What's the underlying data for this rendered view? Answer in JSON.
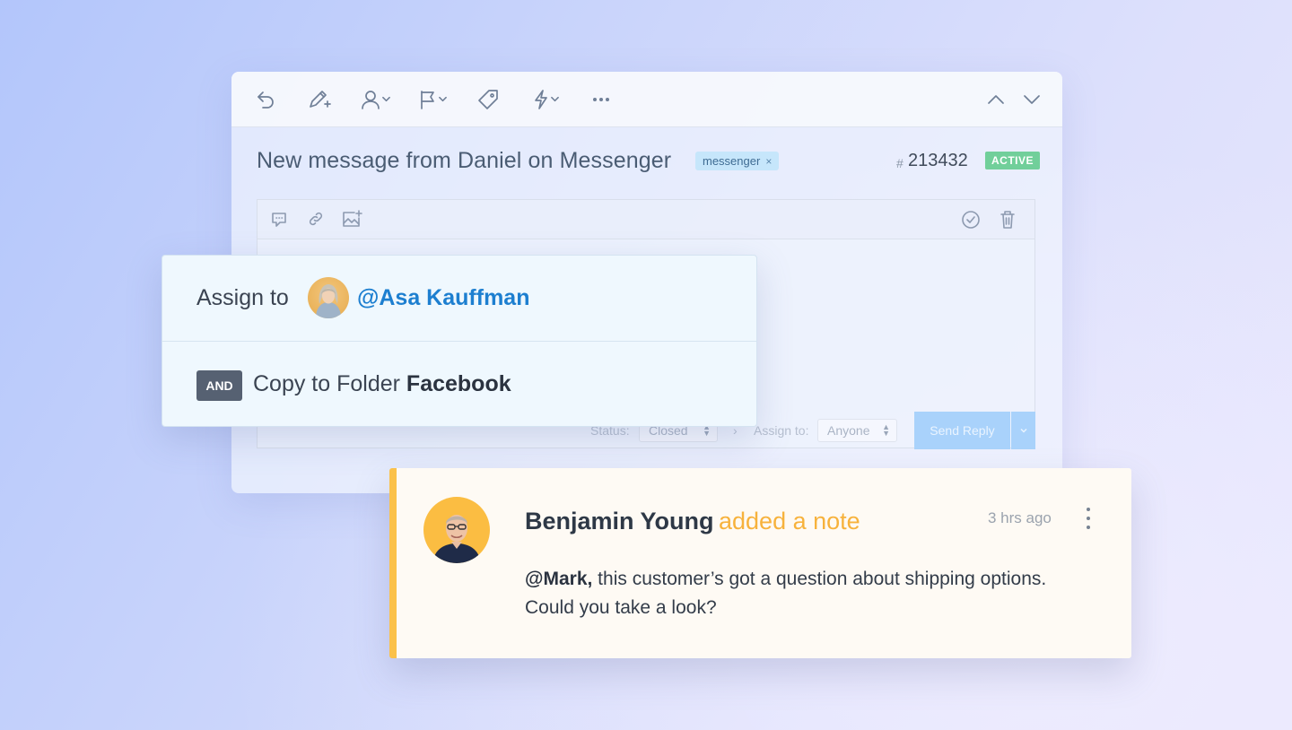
{
  "colors": {
    "accent_blue": "#1d7fd0",
    "active_green": "#71cf9a",
    "note_yellow": "#fbc14a",
    "tag_bg": "#c6e6fb"
  },
  "toolbar": {
    "icons": [
      "undo-icon",
      "edit-note-icon",
      "assign-user-icon",
      "flag-icon",
      "tag-icon",
      "workflow-bolt-icon",
      "more-icon"
    ],
    "nav": [
      "previous-icon",
      "next-icon"
    ]
  },
  "conversation": {
    "subject": "New message from Daniel on Messenger",
    "tag": "messenger",
    "tag_remove": "×",
    "hash": "#",
    "number": "213432",
    "status": "ACTIVE"
  },
  "editor": {
    "icons": [
      "saved-reply-icon",
      "link-icon",
      "image-icon",
      "check-circle-icon",
      "trash-icon"
    ],
    "status_label": "Status:",
    "status_value": "Closed",
    "assign_label": "Assign to:",
    "assign_value": "Anyone",
    "send_label": "Send Reply",
    "separator": "›"
  },
  "workflow": {
    "assign_label": "Assign to",
    "assignee": "@Asa Kauffman",
    "and_label": "AND",
    "copy_label": "Copy to Folder",
    "folder": "Facebook"
  },
  "note": {
    "author": "Benjamin Young",
    "action": "added a note",
    "time": "3 hrs ago",
    "mention": "@Mark,",
    "text": " this customer’s got a question about shipping options. Could you take a look?"
  }
}
